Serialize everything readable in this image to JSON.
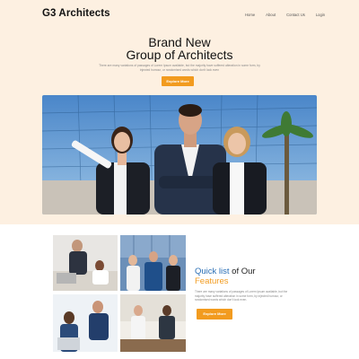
{
  "header": {
    "logo": "G3 Architects",
    "nav": [
      "Home",
      "About",
      "Contact Us",
      "Login"
    ]
  },
  "hero": {
    "title_line1": "Brand New",
    "title_line2": "Group of Architects",
    "subtitle": "There are many variations of passages of Lorem Ipsum available, but the majority have suffered alteration in some form, by injected humour, or randomised words which don't look even",
    "button": "Explore More"
  },
  "features": {
    "title_part1": "Quick list",
    "title_part2": " of Our",
    "title_line2": "Features",
    "subtitle": "There are many variations of passages of Lorem Ipsum available, but the majority have suffered alteration in some form, by injected humour, or randomised words which don't look even.",
    "button": "Explore More"
  },
  "colors": {
    "accent": "#f29b1f",
    "hero_bg": "#fdf0e1",
    "link_blue": "#2a6fb5"
  }
}
